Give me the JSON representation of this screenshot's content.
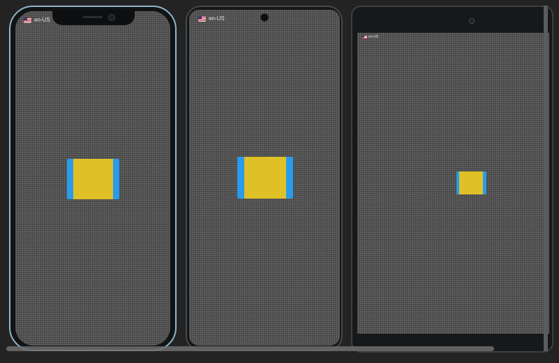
{
  "devices": [
    {
      "type": "iphone",
      "locale": "en-US"
    },
    {
      "type": "android-phone",
      "locale": "en-US"
    },
    {
      "type": "tablet",
      "locale": "en-US"
    }
  ],
  "colors": {
    "background": "#232323",
    "widget_outer": "#2a9bea",
    "widget_inner": "#dfc026",
    "iphone_frame": "#8fb7cf"
  },
  "icons": {
    "locale_flag": "us-flag-icon"
  }
}
